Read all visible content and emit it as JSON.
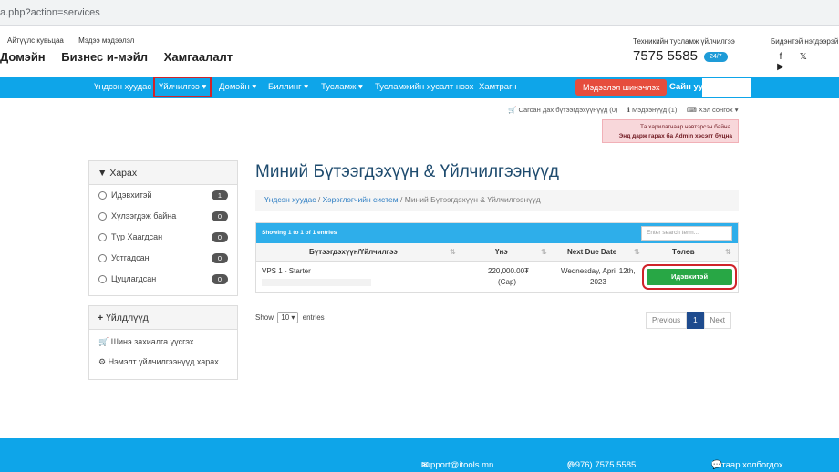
{
  "browser": {
    "url": "a.php?action=services"
  },
  "top_links": [
    "Айтүүлс кувьцаа",
    "Мэдээ мэдээлэл"
  ],
  "top_nav": [
    "Домэйн",
    "Бизнес и-мэйл",
    "Хамгаалалт"
  ],
  "support": {
    "label": "Техникийн тусламж үйлчилгээ",
    "phone": "7575 5585",
    "badge": "24/7"
  },
  "social": {
    "label": "Бидэнтэй нэгдээрэй",
    "icons": [
      "facebook-icon",
      "twitter-icon",
      "youtube-icon"
    ],
    "glyphs": [
      "f",
      "𝕏",
      "▶"
    ]
  },
  "navbar": {
    "items": [
      "Үндсэн хуудас",
      "Үйлчилгээ",
      "Домэйн",
      "Биллинг",
      "Тусламж",
      "Тусламжийн хусалт нээх",
      "Хамтрагч"
    ],
    "active": "Үйлчилгээ",
    "cta": "Мэдээлэл шинэчлэх",
    "hello": "Сайн уу,"
  },
  "utility": {
    "cart": "Сагсан дах бүтээгдэхүүнүүд (0)",
    "notifications": "Мэдээнүүд (1)",
    "language": "Хэл сонгох"
  },
  "alert": {
    "line1": "Та харилагчаар нэвтэрсэн байна.",
    "line2": "Энд дарж гарах ба Admin хэсэгт буцна"
  },
  "sidebar": {
    "filter_title": "Харах",
    "filters": [
      {
        "label": "Идэвхитэй",
        "count": "1"
      },
      {
        "label": "Хүлээгдэж байна",
        "count": "0"
      },
      {
        "label": "Түр Хаагдсан",
        "count": "0"
      },
      {
        "label": "Устгадсан",
        "count": "0"
      },
      {
        "label": "Цуцлагдсан",
        "count": "0"
      }
    ],
    "actions_title": "Үйлдлүүд",
    "actions": [
      "Шинэ захиалга үүсгэх",
      "Нэмэлт үйлчилгээнүүд харах"
    ]
  },
  "main": {
    "title": "Миний Бүтээгдэхүүн & Үйлчилгээнүүд",
    "breadcrumb": [
      "Үндсэн хуудас",
      "Хэрэглэгчийн систем",
      "Миний Бүтээгдэхүүн & Үйлчилгээнүүд"
    ],
    "showing": "Showing 1 to 1 of 1 entries",
    "search_placeholder": "Enter search term...",
    "columns": [
      "Бүтээгдэхүүн/Үйлчилгээ",
      "Үнэ",
      "Next Due Date",
      "Төлөв"
    ],
    "row": {
      "product": "VPS 1 - Starter",
      "price": "220,000.00₮",
      "cycle": "(Сар)",
      "due1": "Wednesday, April 12th,",
      "due2": "2023",
      "status": "Идэвхитэй"
    },
    "length": {
      "show": "Show",
      "value": "10",
      "entries": "entries"
    },
    "pager": {
      "prev": "Previous",
      "page": "1",
      "next": "Next"
    }
  },
  "footer": {
    "email": "support@itools.mn",
    "phone": "(+976) 7575 5585",
    "chat": "Чатаар холбогдох"
  }
}
